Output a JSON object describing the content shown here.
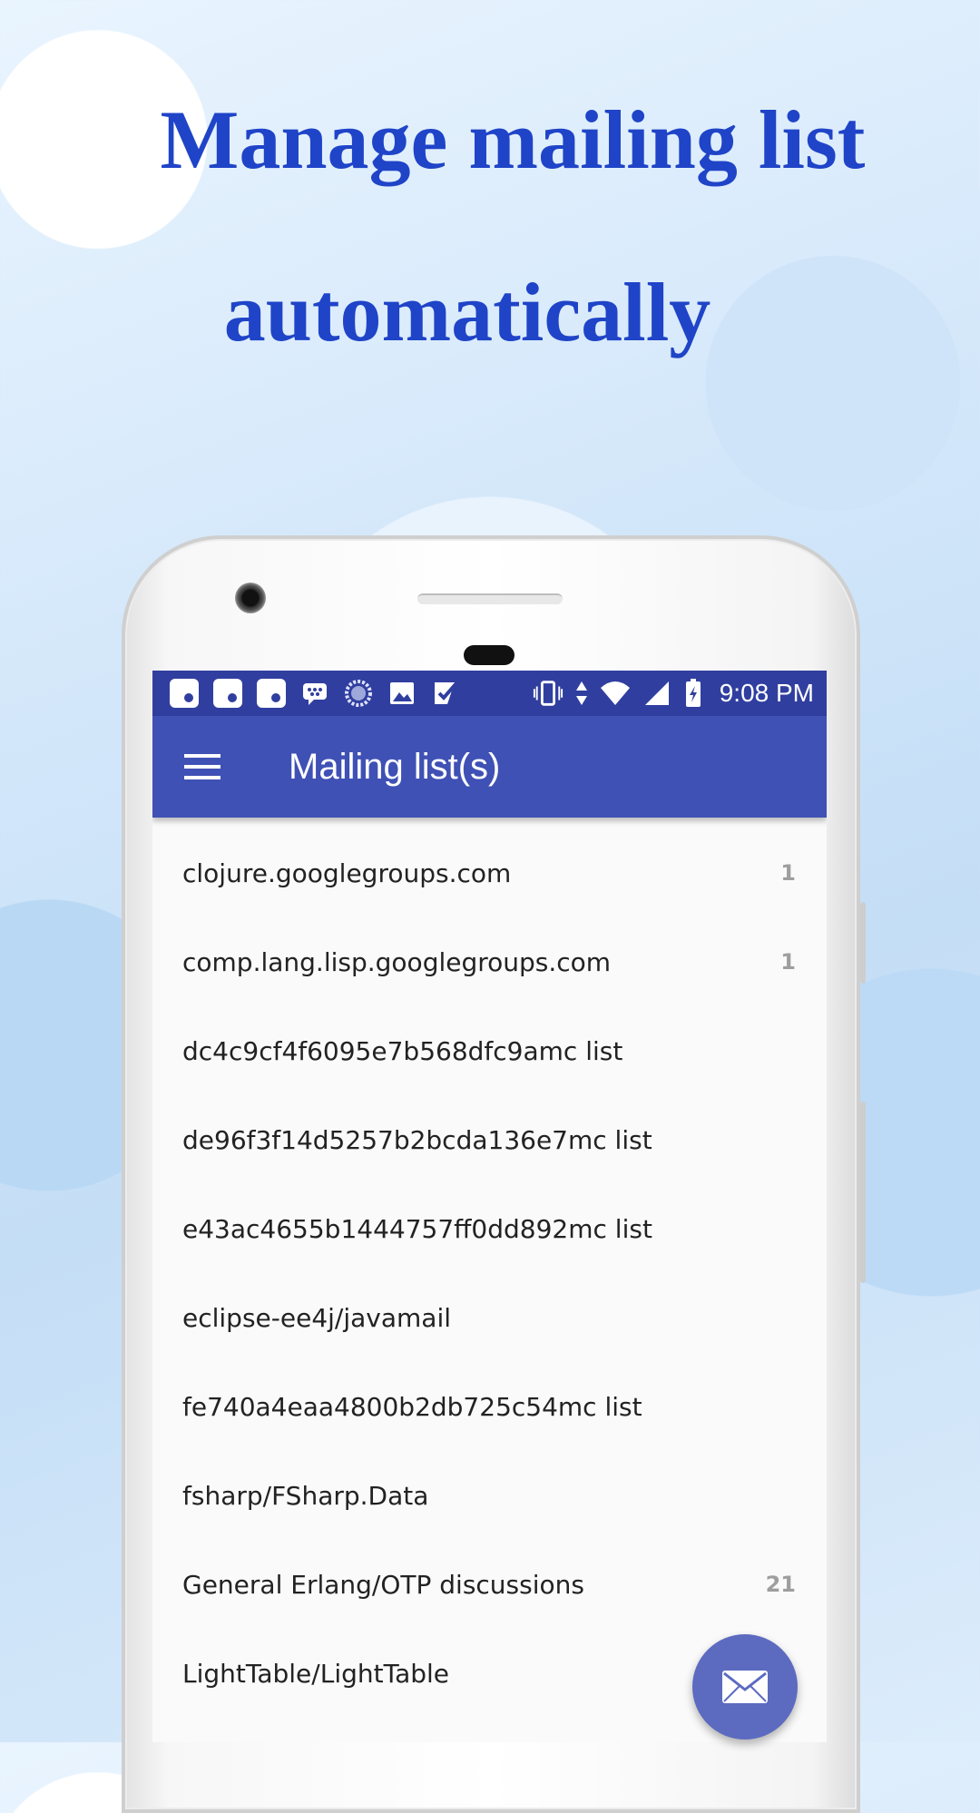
{
  "promo": {
    "line1": "Manage mailing list",
    "line2": "automatically"
  },
  "status_bar": {
    "notification_icons": [
      "notification-icon",
      "notification-icon",
      "notification-icon",
      "bbm-icon",
      "sync-icon",
      "image-icon",
      "check-icon"
    ],
    "system_icons": [
      "vibrate-icon",
      "data-icon",
      "wifi-icon",
      "signal-icon",
      "battery-charging-icon"
    ],
    "time": "9:08 PM"
  },
  "app_bar": {
    "menu_icon": "menu-icon",
    "title": "Mailing list(s)"
  },
  "mailing_lists": [
    {
      "name": "clojure.googlegroups.com",
      "count": "1"
    },
    {
      "name": "comp.lang.lisp.googlegroups.com",
      "count": "1"
    },
    {
      "name": "dc4c9cf4f6095e7b568dfc9amc list",
      "count": ""
    },
    {
      "name": "de96f3f14d5257b2bcda136e7mc list",
      "count": ""
    },
    {
      "name": "e43ac4655b1444757ff0dd892mc list",
      "count": ""
    },
    {
      "name": "eclipse-ee4j/javamail",
      "count": ""
    },
    {
      "name": "fe740a4eaa4800b2db725c54mc list",
      "count": ""
    },
    {
      "name": "fsharp/FSharp.Data",
      "count": ""
    },
    {
      "name": "General Erlang/OTP discussions",
      "count": "21"
    },
    {
      "name": "LightTable/LightTable",
      "count": ""
    }
  ],
  "fab": {
    "icon": "mail-icon"
  },
  "colors": {
    "status_bar": "#303f9f",
    "app_bar": "#3f51b5",
    "fab": "#5c6bc0",
    "headline": "#1f44c8"
  }
}
